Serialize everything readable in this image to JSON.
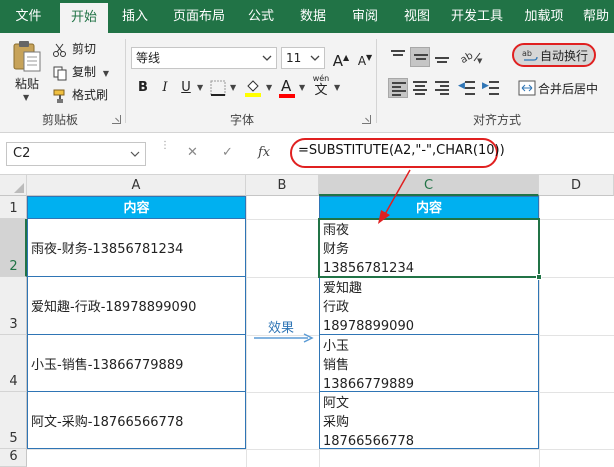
{
  "tabs": [
    "文件",
    "开始",
    "插入",
    "页面布局",
    "公式",
    "数据",
    "审阅",
    "视图",
    "开发工具",
    "加载项",
    "帮助"
  ],
  "clipboard": {
    "paste": "粘贴",
    "cut": "剪切",
    "copy": "复制",
    "format_painter": "格式刷",
    "group": "剪贴板"
  },
  "font": {
    "name": "等线",
    "size": "11",
    "bold": "B",
    "italic": "I",
    "underline": "U",
    "grow": "A",
    "shrink": "A",
    "font_color_letter": "A",
    "phonetic": "wén",
    "phonetic_char": "文",
    "group": "字体"
  },
  "alignment": {
    "wrap_text": "自动换行",
    "merge_center": "合并后居中",
    "group": "对齐方式"
  },
  "formula_bar": {
    "cell_ref": "C2",
    "fx": "fx",
    "formula": "=SUBSTITUTE(A2,\"-\",CHAR(10))"
  },
  "columns": [
    "A",
    "B",
    "C",
    "D"
  ],
  "rows": [
    "1",
    "2",
    "3",
    "4",
    "5",
    "6"
  ],
  "table": {
    "header_a": "内容",
    "header_c": "内容",
    "source": [
      "雨夜-财务-13856781234",
      "爱知趣-行政-18978899090",
      "小玉-销售-13866779889",
      "阿文-采购-18766566778"
    ],
    "result": [
      [
        "雨夜",
        "财务",
        "13856781234"
      ],
      [
        "爱知趣",
        "行政",
        "18978899090"
      ],
      [
        "小玉",
        "销售",
        "13866779889"
      ],
      [
        "阿文",
        "采购",
        "18766566778"
      ]
    ]
  },
  "annotation": {
    "effect_label": "效果"
  },
  "colors": {
    "excel_green": "#217346",
    "header_fill": "#00b0f0",
    "table_border": "#2f75b5",
    "annotation_red": "#e02020",
    "effect_blue": "#5b9bd5"
  }
}
